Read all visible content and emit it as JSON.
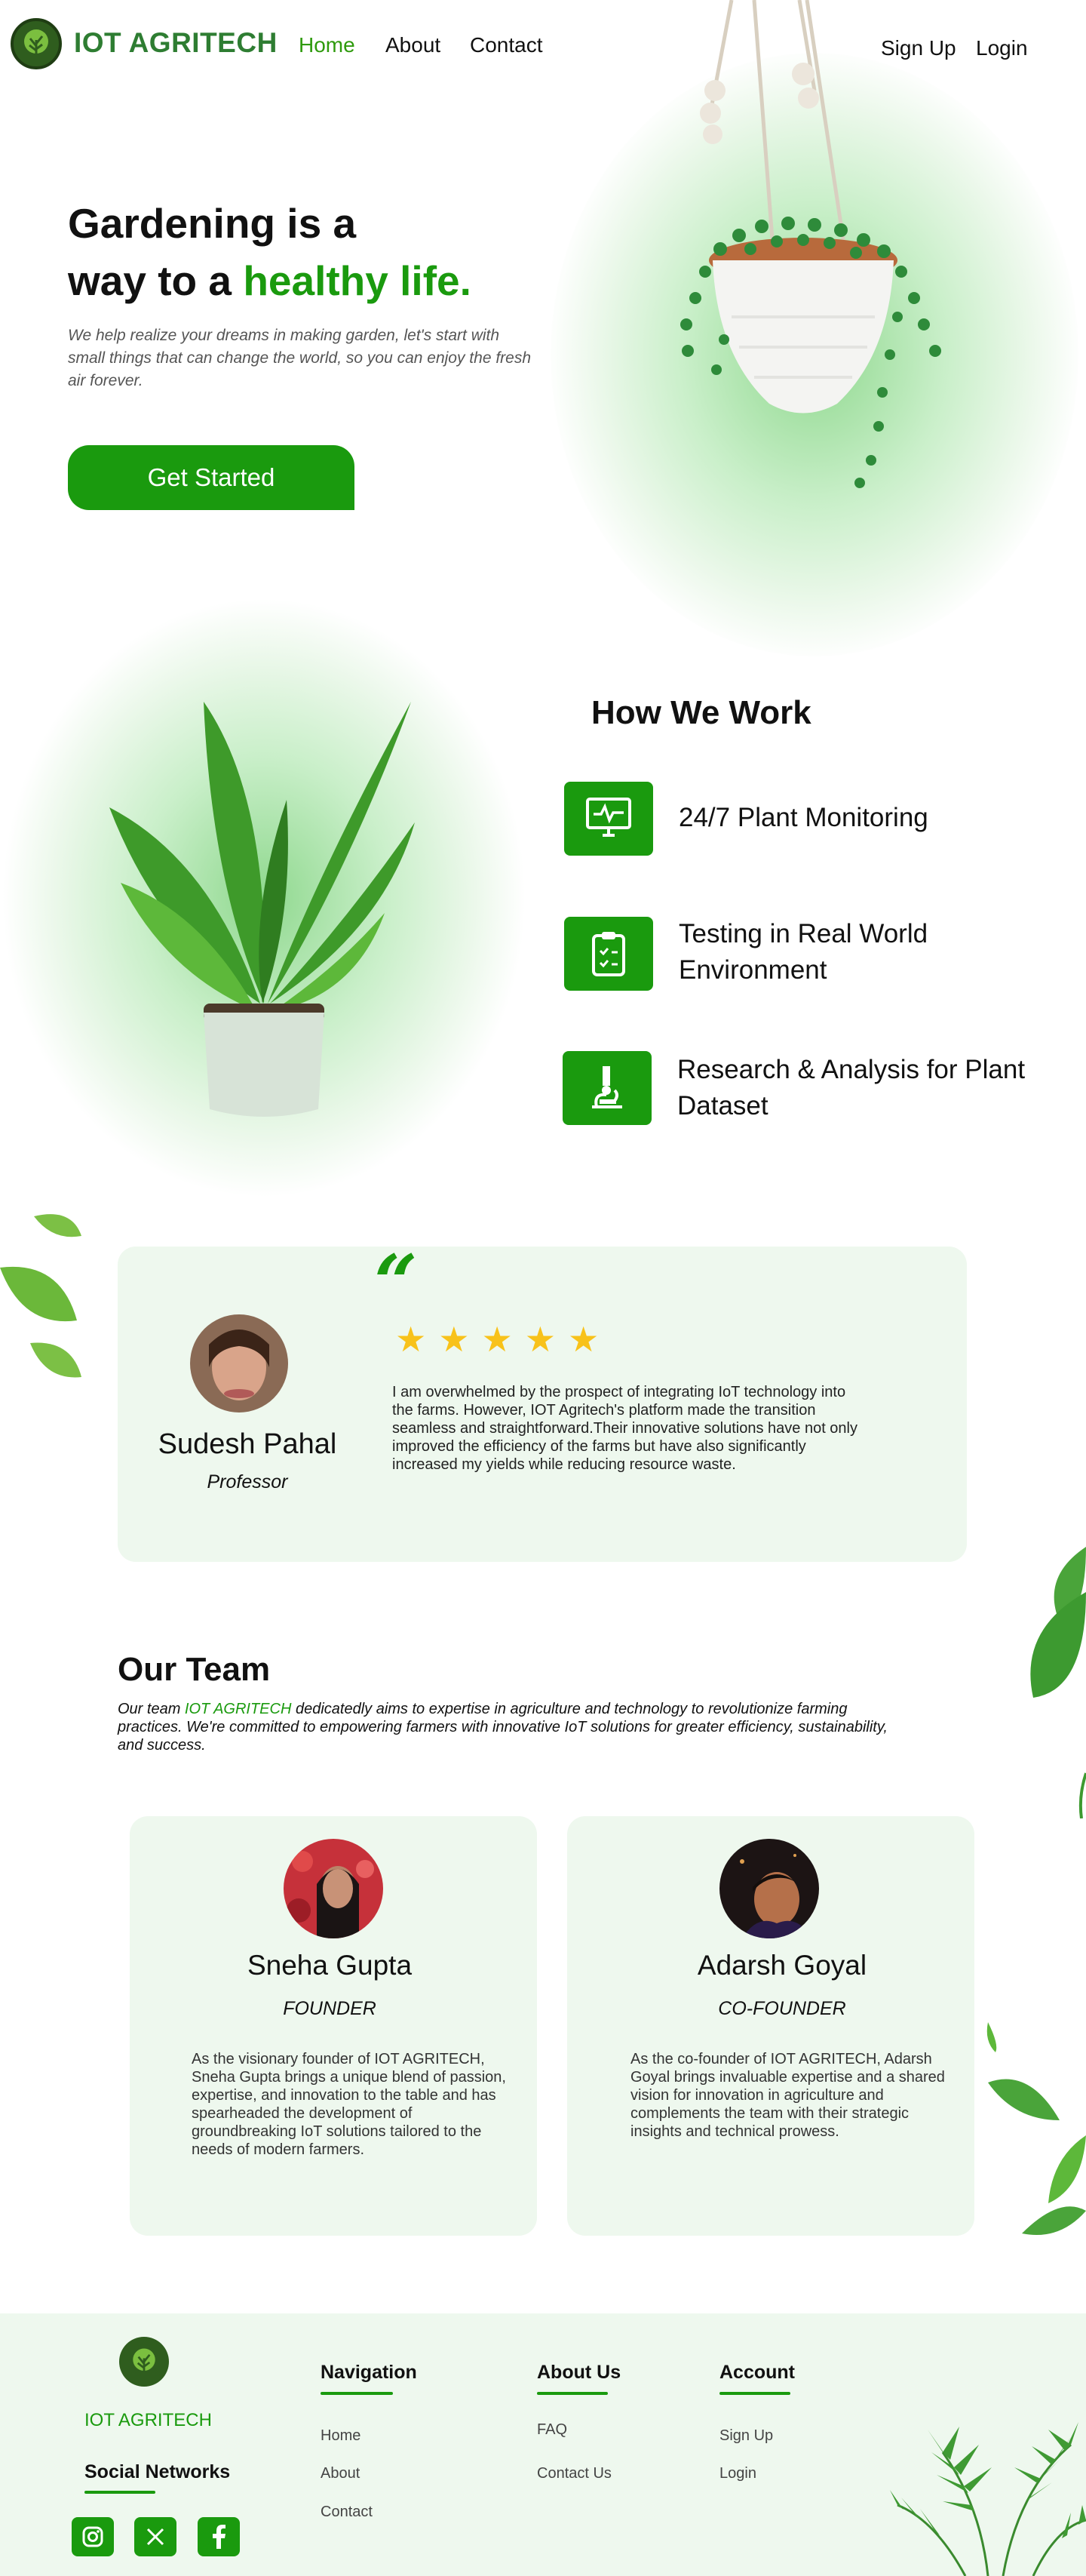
{
  "brand": {
    "name": "IOT AGRITECH",
    "color": "#1a9a0e"
  },
  "nav": {
    "home": "Home",
    "about": "About",
    "contact": "Contact",
    "signup": "Sign Up",
    "login": "Login"
  },
  "hero": {
    "title_line1": "Gardening is a",
    "title_line2_prefix": "way to a ",
    "title_line2_accent": "healthy life.",
    "description": "We help realize your dreams in making garden, let's start with small things that can change the world, so you can enjoy the fresh air forever.",
    "cta": "Get Started"
  },
  "how_we_work": {
    "title": "How We Work",
    "items": [
      {
        "label": "24/7 Plant Monitoring",
        "icon": "monitor-icon"
      },
      {
        "label": "Testing in Real World Environment",
        "icon": "clipboard-icon"
      },
      {
        "label": "Research & Analysis for Plant Dataset",
        "icon": "microscope-icon"
      }
    ]
  },
  "testimonial": {
    "quote_mark": "“",
    "name": "Sudesh Pahal",
    "role": "Professor",
    "stars": [
      "★",
      "★",
      "★",
      "★",
      "★"
    ],
    "rating": 5,
    "text": "I am overwhelmed by the prospect of integrating IoT technology into the farms. However, IOT Agritech's platform made the transition seamless and straightforward.Their innovative solutions have not only improved the efficiency of the farms but have also significantly increased my yields while reducing resource waste."
  },
  "team": {
    "title": "Our Team",
    "desc_prefix": "Our team ",
    "desc_accent": "IOT AGRITECH",
    "desc_suffix": " dedicatedly aims to expertise in agriculture and technology to revolutionize farming practices. We're committed to empowering farmers with innovative IoT solutions for greater efficiency, sustainability, and success.",
    "members": [
      {
        "name": "Sneha Gupta",
        "role": "FOUNDER",
        "bio": "As the visionary founder of IOT AGRITECH, Sneha Gupta brings a unique blend of passion, expertise, and innovation to the table and has spearheaded the development of groundbreaking IoT solutions tailored to the needs of modern farmers."
      },
      {
        "name": "Adarsh Goyal",
        "role": "CO-FOUNDER",
        "bio": "As the co-founder of IOT AGRITECH, Adarsh Goyal brings invaluable expertise and a shared vision for innovation in agriculture and  complements the team with their strategic insights and technical prowess."
      }
    ]
  },
  "footer": {
    "brand": "IOT AGRITECH",
    "social_title": "Social Networks",
    "navigation": {
      "title": "Navigation",
      "links": [
        "Home",
        "About",
        "Contact"
      ]
    },
    "about": {
      "title": "About Us",
      "links": [
        "FAQ",
        "Contact Us"
      ]
    },
    "account": {
      "title": "Account",
      "links": [
        "Sign Up",
        "Login"
      ]
    },
    "social_icons": [
      "instagram-icon",
      "x-icon",
      "facebook-icon"
    ]
  }
}
